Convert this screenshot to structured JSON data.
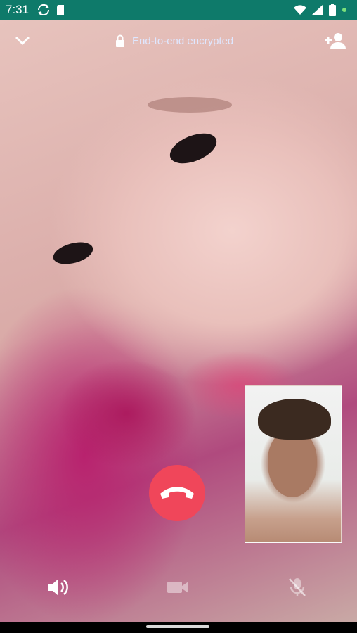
{
  "status_bar": {
    "time": "7:31",
    "left_icons": [
      "sync-icon",
      "sd-card-icon"
    ],
    "right_icons": [
      "wifi-icon",
      "signal-icon",
      "battery-icon",
      "dot-icon"
    ],
    "color": "#0e7a6a"
  },
  "header": {
    "minimize_icon": "chevron-down-icon",
    "encryption_label": "End-to-end encrypted",
    "lock_icon": "lock-icon",
    "add_participant_icon": "add-person-icon"
  },
  "call": {
    "end_call_icon": "phone-hangup-icon",
    "end_call_color": "#f0465a"
  },
  "controls": {
    "speaker_icon": "speaker-icon",
    "video_icon": "video-camera-icon",
    "mute_icon": "microphone-off-icon"
  }
}
